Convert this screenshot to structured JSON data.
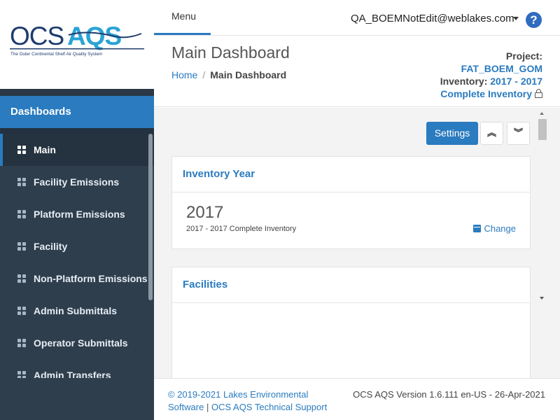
{
  "logo": {
    "wordmark_left": "OCS",
    "wordmark_right": "AQS",
    "tagline": "The Outer Continental Shelf Air Quality System",
    "colors": {
      "dark": "#1f3c6e",
      "light": "#29a3d6"
    }
  },
  "sidebar": {
    "section_title": "Dashboards",
    "items": [
      {
        "label": "Main",
        "icon": "grid-icon",
        "active": true
      },
      {
        "label": "Facility Emissions",
        "icon": "grid-icon"
      },
      {
        "label": "Platform Emissions",
        "icon": "grid-icon"
      },
      {
        "label": "Facility",
        "icon": "grid-icon"
      },
      {
        "label": "Non-Platform Emissions",
        "icon": "grid-icon"
      },
      {
        "label": "Admin Submittals",
        "icon": "grid-icon"
      },
      {
        "label": "Operator Submittals",
        "icon": "grid-icon"
      },
      {
        "label": "Admin Transfers",
        "icon": "grid-icon"
      }
    ]
  },
  "topbar": {
    "menu_label": "Menu",
    "user": "QA_BOEMNotEdit@weblakes.com",
    "help_glyph": "?"
  },
  "header": {
    "title": "Main Dashboard",
    "breadcrumb": {
      "home": "Home",
      "separator": "/",
      "current": "Main Dashboard"
    },
    "project": {
      "project_label": "Project:",
      "project_value": "FAT_BOEM_GOM",
      "inventory_label": "Inventory:",
      "inventory_value": "2017 - 2017",
      "inventory_type": "Complete Inventory"
    }
  },
  "toolbar": {
    "settings_label": "Settings",
    "collapse_glyph": "︽",
    "expand_glyph": "︾"
  },
  "panels": {
    "inventory_year": {
      "title": "Inventory Year",
      "year": "2017",
      "description": "2017 - 2017 Complete Inventory",
      "change_label": "Change"
    },
    "facilities": {
      "title": "Facilities"
    }
  },
  "footer": {
    "copyright_line1": "© 2019-2021 Lakes Environmental",
    "copyright_software": "Software",
    "copyright_sep": "|",
    "support_link": "OCS AQS Technical Support",
    "version": "OCS AQS Version 1.6.111 en-US - 26-Apr-2021"
  },
  "colors": {
    "accent": "#2a7bbf",
    "sidebar_bg": "#2f3e4d",
    "help_icon": "#2f6cc0"
  }
}
